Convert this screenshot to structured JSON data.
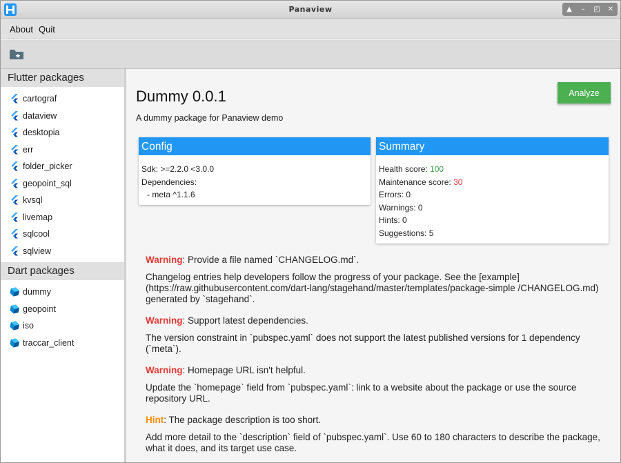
{
  "window": {
    "title": "Panaview",
    "controls": [
      "▲",
      "–",
      "◰",
      "✕"
    ]
  },
  "menu": {
    "about": "About",
    "quit": "Quit"
  },
  "toolbar": {
    "open_icon": "folder-star-icon"
  },
  "sidebar": {
    "flutter_heading": "Flutter packages",
    "flutter_packages": [
      "cartograf",
      "dataview",
      "desktopia",
      "err",
      "folder_picker",
      "geopoint_sql",
      "kvsql",
      "livemap",
      "sqlcool",
      "sqlview"
    ],
    "dart_heading": "Dart packages",
    "dart_packages": [
      "dummy",
      "geopoint",
      "iso",
      "traccar_client"
    ]
  },
  "main": {
    "title": "Dummy 0.0.1",
    "description": "A dummy package for Panaview demo",
    "analyze_label": "Analyze",
    "config": {
      "heading": "Config",
      "sdk": "Sdk: >=2.2.0 <3.0.0",
      "deps_label": "Dependencies:",
      "dep": "- meta ^1.1.6"
    },
    "summary": {
      "heading": "Summary",
      "health_label": "Health score: ",
      "health_value": "100",
      "maintenance_label": "Maintenance score: ",
      "maintenance_value": "30",
      "errors": "Errors: 0",
      "warnings": "Warnings: 0",
      "hints": "Hints: 0",
      "suggestions": "Suggestions: 5"
    },
    "issues": [
      {
        "level": "Warning",
        "title": ": Provide a file named `CHANGELOG.md`.",
        "body": "Changelog entries help developers follow the progress of your package. See the [example](https://raw.githubusercontent.com/dart-lang/stagehand/master/templates/package-simple /CHANGELOG.md) generated by `stagehand`."
      },
      {
        "level": "Warning",
        "title": ": Support latest dependencies.",
        "body": "The version constraint in `pubspec.yaml` does not support the latest published versions for 1 dependency (`meta`)."
      },
      {
        "level": "Warning",
        "title": ": Homepage URL isn't helpful.",
        "body": "Update the `homepage` field from `pubspec.yaml`: link to a website about the package or use the source repository URL."
      },
      {
        "level": "Hint",
        "title": ": The package description is too short.",
        "body": "Add more detail to the `description` field of `pubspec.yaml`. Use 60 to 180 characters to describe the package, what it does, and its target use case."
      }
    ]
  },
  "colors": {
    "accent_blue": "#2196f3",
    "analyze_green": "#4caf50",
    "warning_red": "#e53935",
    "hint_orange": "#fb8c00",
    "health_green": "#43a047"
  }
}
